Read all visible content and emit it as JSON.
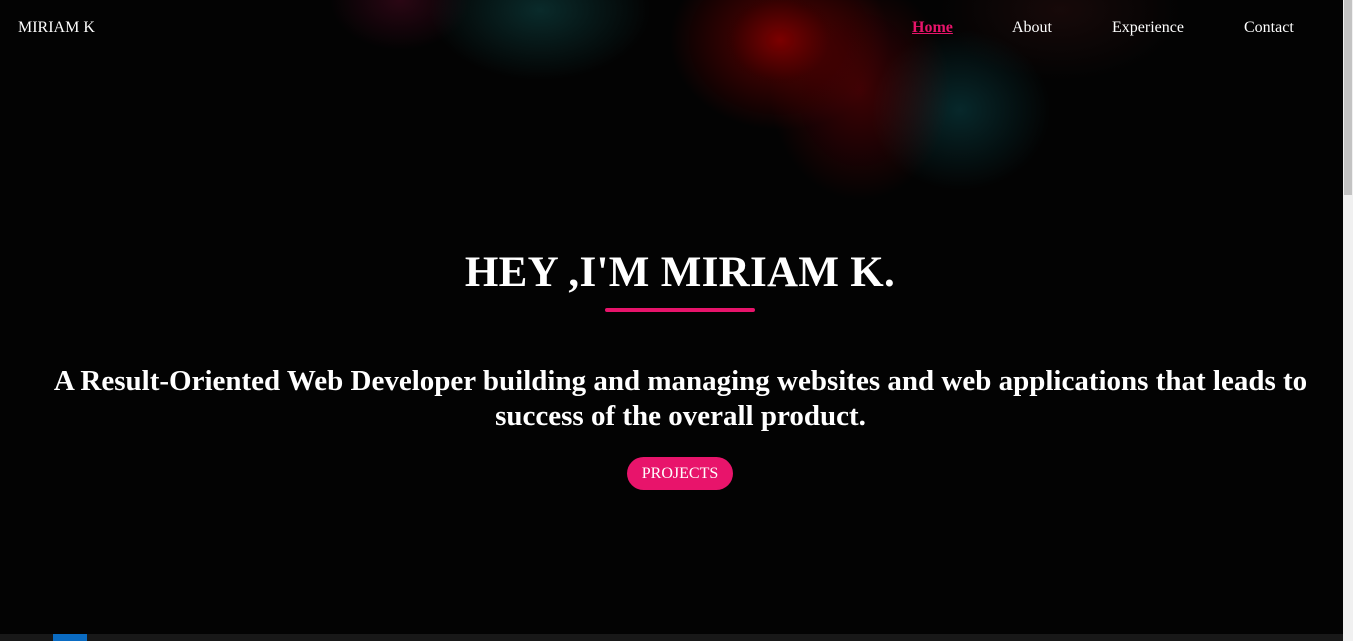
{
  "navbar": {
    "brand": "MIRIAM K",
    "links": [
      {
        "label": "Home",
        "active": true
      },
      {
        "label": "About",
        "active": false
      },
      {
        "label": "Experience",
        "active": false
      },
      {
        "label": "Contact",
        "active": false
      }
    ]
  },
  "hero": {
    "title": "HEY ,I'M MIRIAM K.",
    "subtitle": "A Result-Oriented Web Developer building and managing websites and web applications that leads to success of the overall product.",
    "cta_label": "PROJECTS"
  },
  "colors": {
    "accent": "#e8146b",
    "background": "#030303",
    "text": "#ffffff"
  }
}
